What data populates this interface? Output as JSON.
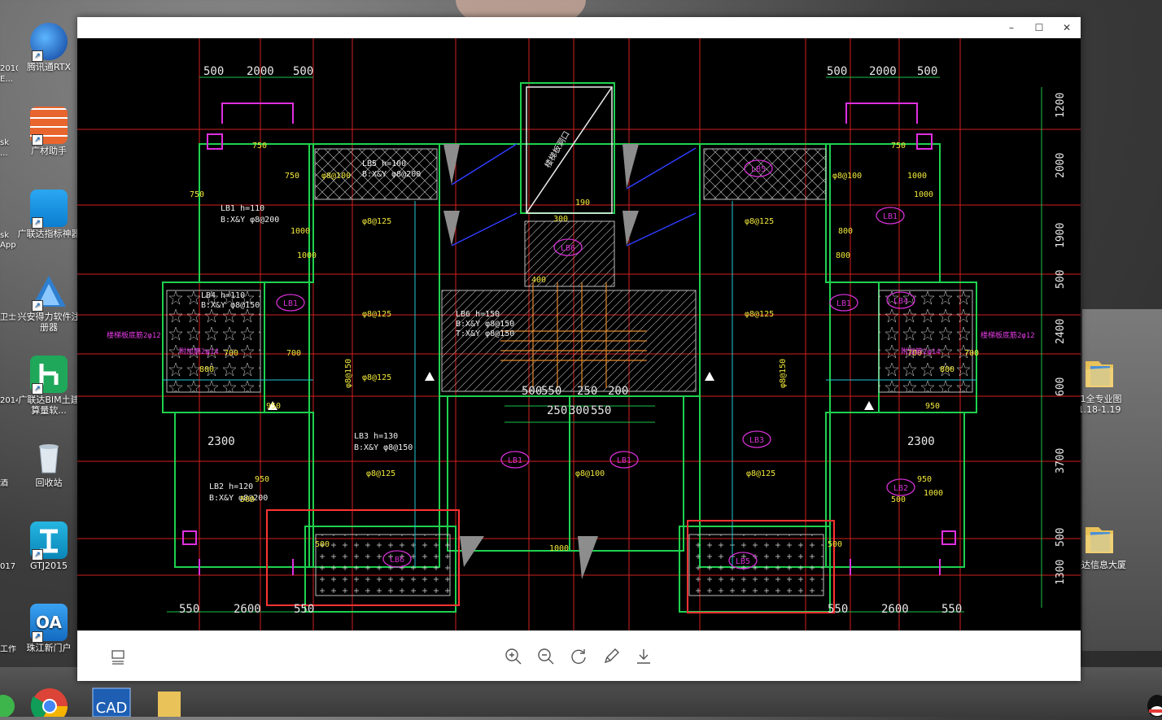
{
  "desktop": {
    "left_partial": [
      "2010",
      "E...",
      "sk",
      "...",
      "sk",
      "App",
      "卫士",
      "2014",
      "酒",
      "017",
      "工作"
    ],
    "icons": [
      {
        "label": "腾讯通RTX",
        "icon": "rtx-icon"
      },
      {
        "label": "广材助手",
        "icon": "brick-icon"
      },
      {
        "label": "广联达指标神器",
        "icon": "cloud-icon"
      },
      {
        "label": "兴安得力软件注册器",
        "icon": "pyramid-icon"
      },
      {
        "label": "广联达BIM土建算量软...",
        "icon": "glodon-icon"
      },
      {
        "label": "回收站",
        "icon": "recycle-bin-icon"
      },
      {
        "label": "GTJ2015",
        "icon": "gtj-icon"
      },
      {
        "label": "珠江新门户",
        "icon": "oa-icon"
      }
    ],
    "right_icons": [
      {
        "label": "-1全专业图1.18-1.19",
        "icon": "folder-icon"
      },
      {
        "label": "联达信息大厦",
        "icon": "folder-icon"
      }
    ]
  },
  "viewer": {
    "controls": {
      "minimize": "–",
      "maximize": "☐",
      "close": "✕"
    },
    "toolbar": {
      "left": "filmstrip-icon",
      "buttons": [
        "zoom-in-icon",
        "zoom-out-icon",
        "rotate-icon",
        "edit-icon",
        "download-icon"
      ]
    }
  },
  "drawing": {
    "top_dims_left": [
      "500",
      "2000",
      "500"
    ],
    "top_dims_right": [
      "500",
      "2000",
      "500"
    ],
    "right_dims": [
      "1200",
      "2000",
      "1900",
      "500",
      "2400",
      "600",
      "3700",
      "500",
      "1300"
    ],
    "bottom_dims_left": [
      "550",
      "2600",
      "550"
    ],
    "bottom_dims_right": [
      "550",
      "2600",
      "550"
    ],
    "mid_dims_row1": [
      "500",
      "550",
      "250",
      "200"
    ],
    "mid_dims_row2": [
      "250",
      "300",
      "550"
    ],
    "slab_labels": [
      "LB1",
      "LB2",
      "LB3",
      "LB4",
      "LB5",
      "LB6"
    ],
    "notes": [
      "LB5 h=100",
      "B:X&Y φ8@200",
      "LB1 h=110",
      "B:X&Y φ8@200",
      "LB4 h=110",
      "B:X&Y φ8@150",
      "LB6 h=150",
      "B:X&Y φ8@150",
      "T:X&Y φ8@150",
      "LB3 h=130",
      "B:X&Y φ8@150",
      "LB2 h=120",
      "B:X&Y φ8@200"
    ],
    "rebar": [
      "φ8@125",
      "φ8@125",
      "φ8@125",
      "φ8@125",
      "φ8@125",
      "φ8@125",
      "φ8@150",
      "φ8@150",
      "φ8@100",
      "φ8@125",
      "φ8@100",
      "φ8@100"
    ],
    "small_dims": [
      "750",
      "750",
      "750",
      "750",
      "1000",
      "1000",
      "1000",
      "1000",
      "800",
      "800",
      "800",
      "800",
      "950",
      "950",
      "950",
      "950",
      "500",
      "500",
      "500",
      "500",
      "300",
      "400",
      "190",
      "700",
      "700",
      "700",
      "700",
      "1000",
      "1000"
    ],
    "letters": [
      "2300",
      "2300"
    ],
    "magenta_notes": [
      "楼梯板底筋2φ12",
      "楼梯板底筋2φ12",
      "附加筋2φ14",
      "附加筋2φ14"
    ],
    "stair_text": "楼梯板洞口"
  }
}
